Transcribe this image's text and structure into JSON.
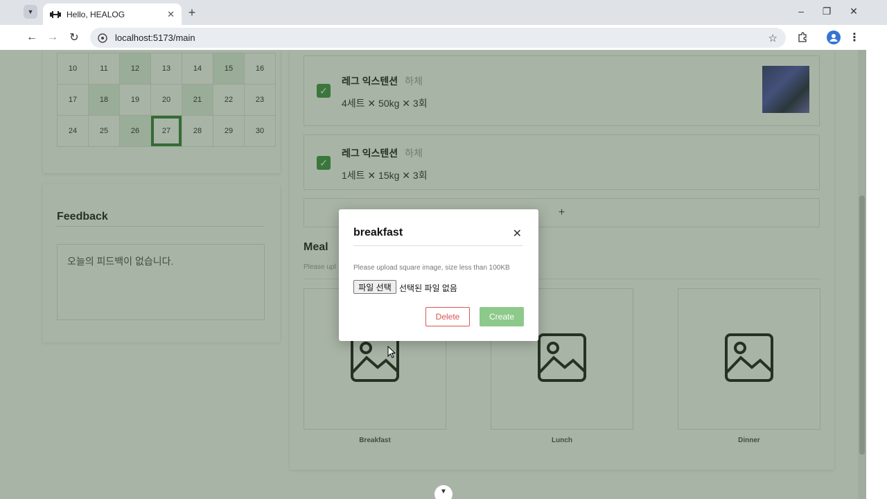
{
  "browser": {
    "tab_title": "Hello, HEALOG",
    "url": "localhost:5173/main"
  },
  "calendar": {
    "rows": [
      [
        "10",
        "11",
        "12",
        "13",
        "14",
        "15",
        "16"
      ],
      [
        "17",
        "18",
        "19",
        "20",
        "21",
        "22",
        "23"
      ],
      [
        "24",
        "25",
        "26",
        "27",
        "28",
        "29",
        "30"
      ]
    ],
    "today": "27",
    "active_days": [
      "12",
      "15",
      "18",
      "21",
      "26"
    ]
  },
  "feedback": {
    "title": "Feedback",
    "text": "오늘의 피드백이 없습니다."
  },
  "exercises": [
    {
      "name": "레그 익스텐션",
      "part": "하체",
      "detail": "4세트 ✕ 50kg ✕ 3회",
      "checked": true
    },
    {
      "name": "레그 익스텐션",
      "part": "하체",
      "detail": "1세트 ✕ 15kg ✕ 3회",
      "checked": true
    }
  ],
  "add_label": "+",
  "meal": {
    "title": "Meal",
    "hint": "Please upl",
    "labels": [
      "Breakfast",
      "Lunch",
      "Dinner"
    ]
  },
  "modal": {
    "title": "breakfast",
    "close": "✕",
    "hint": "Please upload square image, size less than 100KB",
    "file_button": "파일 선택",
    "file_status": "선택된 파일 없음",
    "delete_label": "Delete",
    "create_label": "Create"
  },
  "colors": {
    "accent_green": "#3a8f3e",
    "create_green": "#8cc98a",
    "delete_red": "#d9534f",
    "overlay": "#3e583a"
  }
}
